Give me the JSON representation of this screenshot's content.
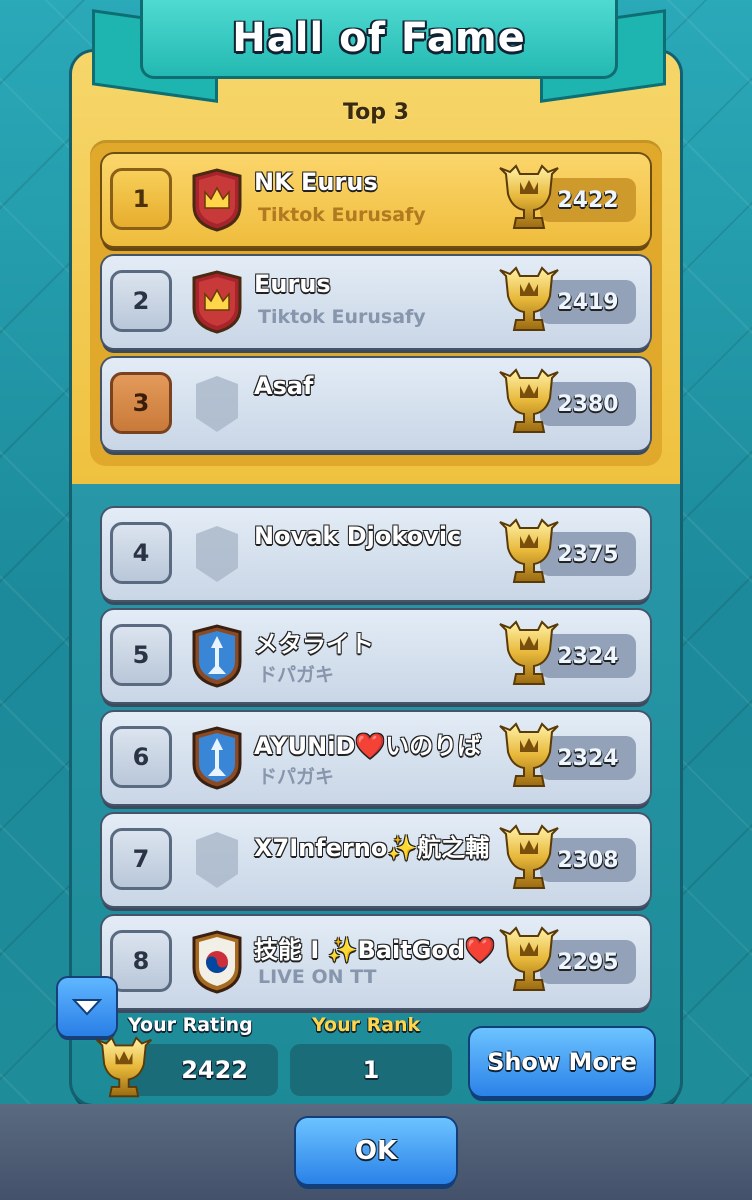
{
  "header": {
    "title": "Hall of Fame",
    "section_label": "Top 3"
  },
  "colors": {
    "gold": "#efbd3d",
    "teal": "#23b9b2",
    "button_blue": "#2b82e8",
    "rank_label": "#ffd54a"
  },
  "players": [
    {
      "rank": "1",
      "name": "NK Eurus",
      "clan": "Tiktok Eurusafy",
      "trophies": "2422",
      "badge": "crown-clan-badge-icon",
      "rank_style": "gold"
    },
    {
      "rank": "2",
      "name": "Eurus",
      "clan": "Tiktok Eurusafy",
      "trophies": "2419",
      "badge": "crown-clan-badge-icon",
      "rank_style": "silver"
    },
    {
      "rank": "3",
      "name": "Asaf",
      "clan": "",
      "trophies": "2380",
      "badge": "empty-shield-icon",
      "rank_style": "bronze"
    },
    {
      "rank": "4",
      "name": "Novak Djokovic",
      "clan": "",
      "trophies": "2375",
      "badge": "empty-shield-icon",
      "rank_style": "silver"
    },
    {
      "rank": "5",
      "name": "メタライト",
      "clan": "ドパガキ",
      "trophies": "2324",
      "badge": "arrow-clan-badge-icon",
      "rank_style": "silver"
    },
    {
      "rank": "6",
      "name": "AYUNiD❤️いのりば",
      "clan": "ドパガキ",
      "trophies": "2324",
      "badge": "arrow-clan-badge-icon",
      "rank_style": "silver"
    },
    {
      "rank": "7",
      "name": "X7Inferno✨航之輔",
      "clan": "",
      "trophies": "2308",
      "badge": "empty-shield-icon",
      "rank_style": "silver"
    },
    {
      "rank": "8",
      "name": "技能 I ✨BaitGod❤️",
      "clan": "LIVE ON TT",
      "trophies": "2295",
      "badge": "korea-clan-badge-icon",
      "rank_style": "silver"
    }
  ],
  "footer": {
    "your_rating_label": "Your Rating",
    "your_rating_value": "2422",
    "your_rank_label": "Your Rank",
    "your_rank_value": "1",
    "show_more_label": "Show More",
    "ok_label": "OK"
  }
}
